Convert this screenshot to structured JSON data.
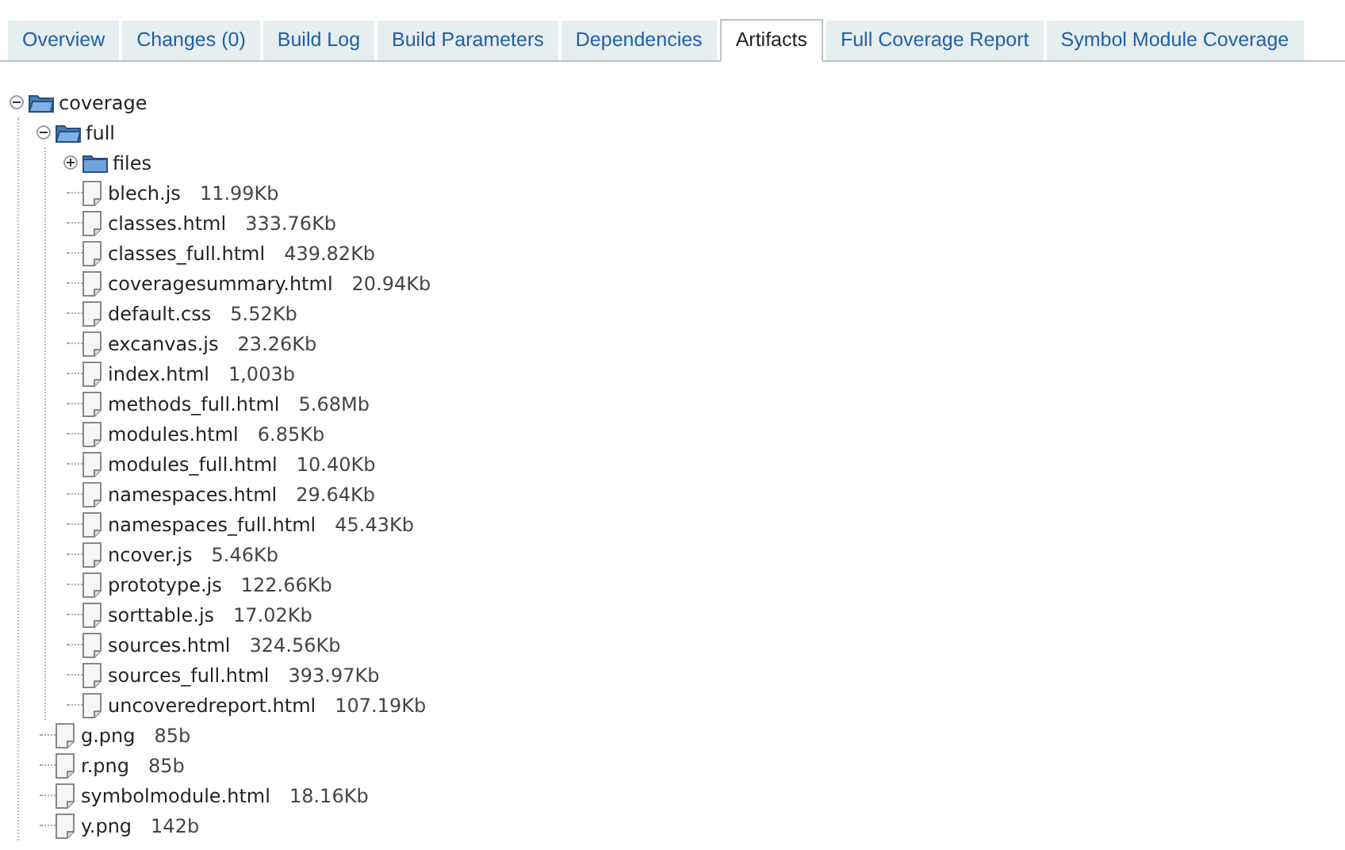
{
  "tabs": [
    {
      "label": "Overview",
      "selected": false
    },
    {
      "label": "Changes (0)",
      "selected": false
    },
    {
      "label": "Build Log",
      "selected": false
    },
    {
      "label": "Build Parameters",
      "selected": false
    },
    {
      "label": "Dependencies",
      "selected": false
    },
    {
      "label": "Artifacts",
      "selected": true
    },
    {
      "label": "Full Coverage Report",
      "selected": false
    },
    {
      "label": "Symbol Module Coverage",
      "selected": false
    }
  ],
  "tree": [
    {
      "kind": "folder",
      "name": "coverage",
      "expanded": true,
      "children": [
        {
          "kind": "folder",
          "name": "full",
          "expanded": true,
          "children": [
            {
              "kind": "folder",
              "name": "files",
              "expanded": false
            },
            {
              "kind": "file",
              "name": "blech.js",
              "size": "11.99Kb"
            },
            {
              "kind": "file",
              "name": "classes.html",
              "size": "333.76Kb"
            },
            {
              "kind": "file",
              "name": "classes_full.html",
              "size": "439.82Kb"
            },
            {
              "kind": "file",
              "name": "coveragesummary.html",
              "size": "20.94Kb"
            },
            {
              "kind": "file",
              "name": "default.css",
              "size": "5.52Kb"
            },
            {
              "kind": "file",
              "name": "excanvas.js",
              "size": "23.26Kb"
            },
            {
              "kind": "file",
              "name": "index.html",
              "size": "1,003b"
            },
            {
              "kind": "file",
              "name": "methods_full.html",
              "size": "5.68Mb"
            },
            {
              "kind": "file",
              "name": "modules.html",
              "size": "6.85Kb"
            },
            {
              "kind": "file",
              "name": "modules_full.html",
              "size": "10.40Kb"
            },
            {
              "kind": "file",
              "name": "namespaces.html",
              "size": "29.64Kb"
            },
            {
              "kind": "file",
              "name": "namespaces_full.html",
              "size": "45.43Kb"
            },
            {
              "kind": "file",
              "name": "ncover.js",
              "size": "5.46Kb"
            },
            {
              "kind": "file",
              "name": "prototype.js",
              "size": "122.66Kb"
            },
            {
              "kind": "file",
              "name": "sorttable.js",
              "size": "17.02Kb"
            },
            {
              "kind": "file",
              "name": "sources.html",
              "size": "324.56Kb"
            },
            {
              "kind": "file",
              "name": "sources_full.html",
              "size": "393.97Kb"
            },
            {
              "kind": "file",
              "name": "uncoveredreport.html",
              "size": "107.19Kb"
            }
          ]
        },
        {
          "kind": "file",
          "name": "g.png",
          "size": "85b"
        },
        {
          "kind": "file",
          "name": "r.png",
          "size": "85b"
        },
        {
          "kind": "file",
          "name": "symbolmodule.html",
          "size": "18.16Kb"
        },
        {
          "kind": "file",
          "name": "y.png",
          "size": "142b"
        }
      ]
    }
  ]
}
